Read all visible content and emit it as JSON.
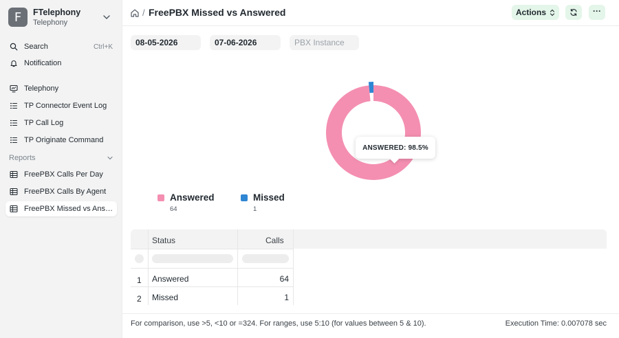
{
  "app": {
    "title": "FTelephony",
    "subtitle": "Telephony",
    "logo_letter": "F"
  },
  "sidebar": {
    "search_label": "Search",
    "search_shortcut": "Ctrl+K",
    "notification_label": "Notification",
    "items": [
      {
        "label": "Telephony",
        "icon": "monitor-icon"
      },
      {
        "label": "TP Connector Event Log",
        "icon": "list-icon"
      },
      {
        "label": "TP Call Log",
        "icon": "list-icon"
      },
      {
        "label": "TP Originate Command",
        "icon": "list-icon"
      }
    ],
    "reports_label": "Reports",
    "reports": [
      {
        "label": "FreePBX Calls Per Day",
        "icon": "table-icon"
      },
      {
        "label": "FreePBX Calls By Agent",
        "icon": "table-icon"
      },
      {
        "label": "FreePBX Missed vs Answered",
        "icon": "table-icon",
        "active": true
      }
    ]
  },
  "header": {
    "title": "FreePBX Missed vs Answered",
    "actions_label": "Actions",
    "more_label": "···"
  },
  "filters": {
    "from_date": "08-05-2026",
    "to_date": "07-06-2026",
    "pbx_placeholder": "PBX Instance"
  },
  "chart_data": {
    "type": "pie",
    "variant": "donut",
    "categories": [
      "Answered",
      "Missed"
    ],
    "values": [
      64,
      1
    ],
    "colors": [
      "#f48fb1",
      "#2f86d3"
    ],
    "tooltip": "ANSWERED: 98.5%",
    "legend_position": "bottom-left"
  },
  "table": {
    "columns": [
      "Status",
      "Calls"
    ],
    "rows": [
      {
        "index": "1",
        "status": "Answered",
        "calls": "64"
      },
      {
        "index": "2",
        "status": "Missed",
        "calls": "1"
      }
    ]
  },
  "footer": {
    "hint": "For comparison, use >5, <10 or =324. For ranges, use 5:10 (for values between 5 & 10).",
    "execution": "Execution Time: 0.007078 sec"
  }
}
